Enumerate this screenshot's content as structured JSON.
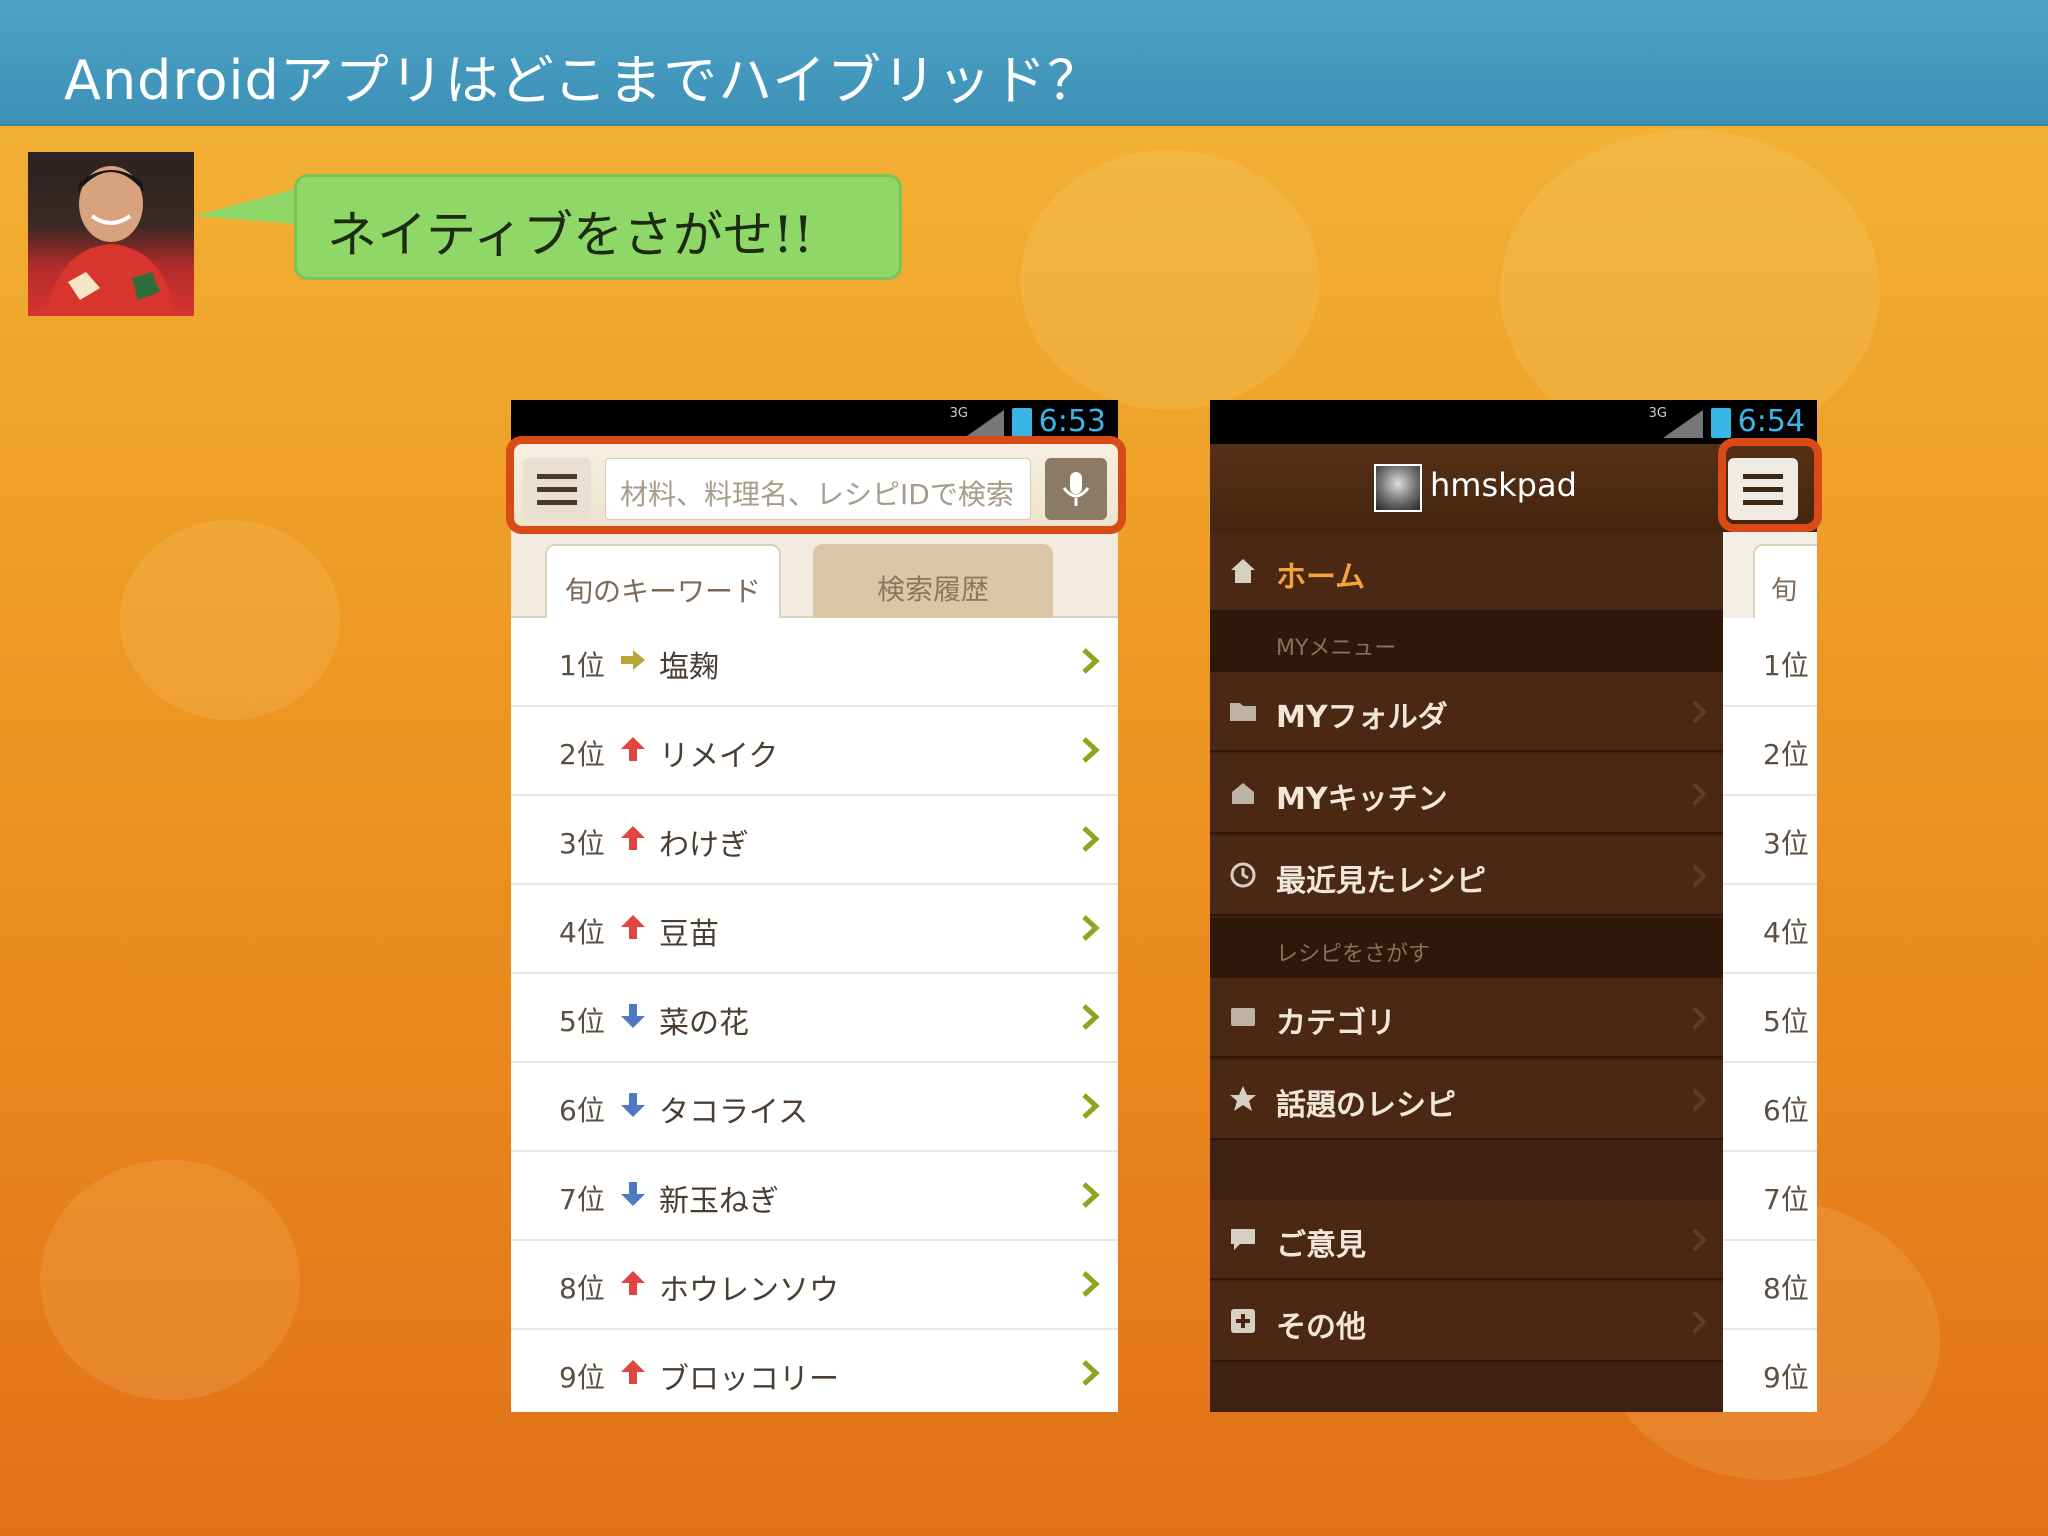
{
  "slide": {
    "title": "Androidアプリはどこまでハイブリッド？",
    "callout": "ネイティブをさがせ!!"
  },
  "colors": {
    "header_blue": "#3f93b8",
    "callout_green": "#8fd868",
    "highlight_red": "#d94a17",
    "drawer_brown": "#4b2814",
    "status_time_blue": "#39b5e6"
  },
  "phone_left": {
    "status": {
      "network": "3G",
      "time": "6:53"
    },
    "search": {
      "menu_icon": "hamburger-icon",
      "placeholder": "材料、料理名、レシピIDで検索",
      "mic_icon": "microphone-icon"
    },
    "tabs": [
      {
        "label": "旬のキーワード",
        "active": true
      },
      {
        "label": "検索履歴",
        "active": false
      }
    ],
    "ranking": [
      {
        "rank": "1位",
        "trend": "same",
        "word": "塩麹"
      },
      {
        "rank": "2位",
        "trend": "up",
        "word": "リメイク"
      },
      {
        "rank": "3位",
        "trend": "up",
        "word": "わけぎ"
      },
      {
        "rank": "4位",
        "trend": "up",
        "word": "豆苗"
      },
      {
        "rank": "5位",
        "trend": "down",
        "word": "菜の花"
      },
      {
        "rank": "6位",
        "trend": "down",
        "word": "タコライス"
      },
      {
        "rank": "7位",
        "trend": "down",
        "word": "新玉ねぎ"
      },
      {
        "rank": "8位",
        "trend": "up",
        "word": "ホウレンソウ"
      },
      {
        "rank": "9位",
        "trend": "up",
        "word": "ブロッコリー"
      }
    ]
  },
  "phone_right": {
    "status": {
      "network": "3G",
      "time": "6:54"
    },
    "header": {
      "user_name": "hmskpad",
      "menu_icon": "hamburger-icon"
    },
    "drawer": {
      "home": {
        "label": "ホーム",
        "icon": "home-icon"
      },
      "section_my": "MYメニュー",
      "my_folder": {
        "label": "MYフォルダ",
        "icon": "folder-icon"
      },
      "my_kitchen": {
        "label": "MYキッチン",
        "icon": "kitchen-icon"
      },
      "recent": {
        "label": "最近見たレシピ",
        "icon": "clock-icon"
      },
      "section_search": "レシピをさがす",
      "category": {
        "label": "カテゴリ",
        "icon": "category-icon"
      },
      "popular": {
        "label": "話題のレシピ",
        "icon": "star-icon"
      },
      "feedback": {
        "label": "ご意見",
        "icon": "speech-bubble-icon"
      },
      "other": {
        "label": "その他",
        "icon": "plus-icon"
      }
    },
    "peek": {
      "tab": "旬",
      "ranks": [
        "1位",
        "2位",
        "3位",
        "4位",
        "5位",
        "6位",
        "7位",
        "8位",
        "9位"
      ]
    }
  }
}
